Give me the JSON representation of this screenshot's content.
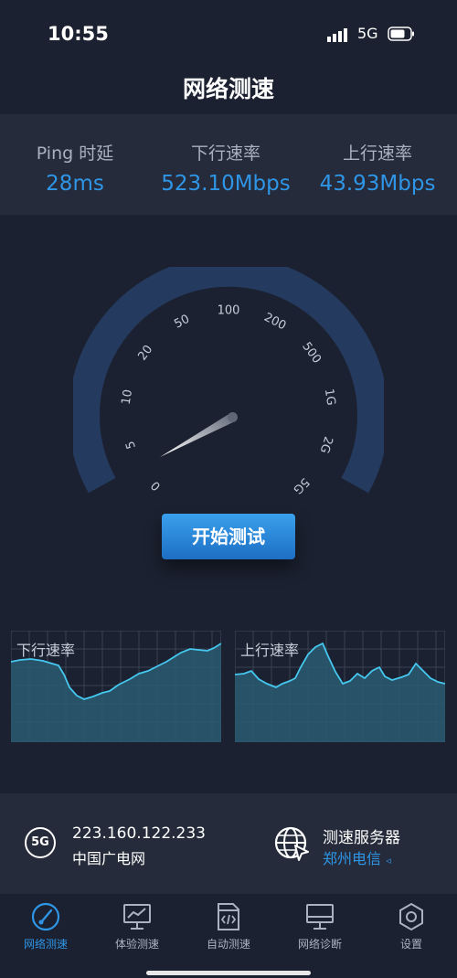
{
  "status_bar": {
    "time": "10:55",
    "network": "5G"
  },
  "header": {
    "title": "网络测速"
  },
  "stats": [
    {
      "label": "Ping 时延",
      "value": "28ms"
    },
    {
      "label": "下行速率",
      "value": "523.10Mbps"
    },
    {
      "label": "上行速率",
      "value": "43.93Mbps"
    }
  ],
  "gauge": {
    "ticks": [
      "0",
      "5",
      "10",
      "20",
      "50",
      "100",
      "200",
      "500",
      "1G",
      "2G",
      "5G"
    ]
  },
  "start_button": {
    "label": "开始测试"
  },
  "graphs": {
    "download": {
      "label": "下行速率"
    },
    "upload": {
      "label": "上行速率"
    }
  },
  "connection": {
    "badge": "5G",
    "ip": "223.160.122.233",
    "isp": "中国广电网",
    "server_label": "测速服务器",
    "server_name": "郑州电信",
    "server_arrow": "◃"
  },
  "tabs": [
    {
      "label": "网络测速",
      "icon": "speedometer-icon",
      "active": true
    },
    {
      "label": "体验测速",
      "icon": "monitor-chart-icon",
      "active": false
    },
    {
      "label": "自动测速",
      "icon": "code-file-icon",
      "active": false
    },
    {
      "label": "网络诊断",
      "icon": "monitor-icon",
      "active": false
    },
    {
      "label": "设置",
      "icon": "hexagon-gear-icon",
      "active": false
    }
  ],
  "colors": {
    "background": "#1b2130",
    "panel": "#252b3a",
    "accent": "#2f95e6",
    "gauge_arc": "#243a5e",
    "graph_fill": "#2a5a72",
    "graph_line": "#45c8ef"
  }
}
